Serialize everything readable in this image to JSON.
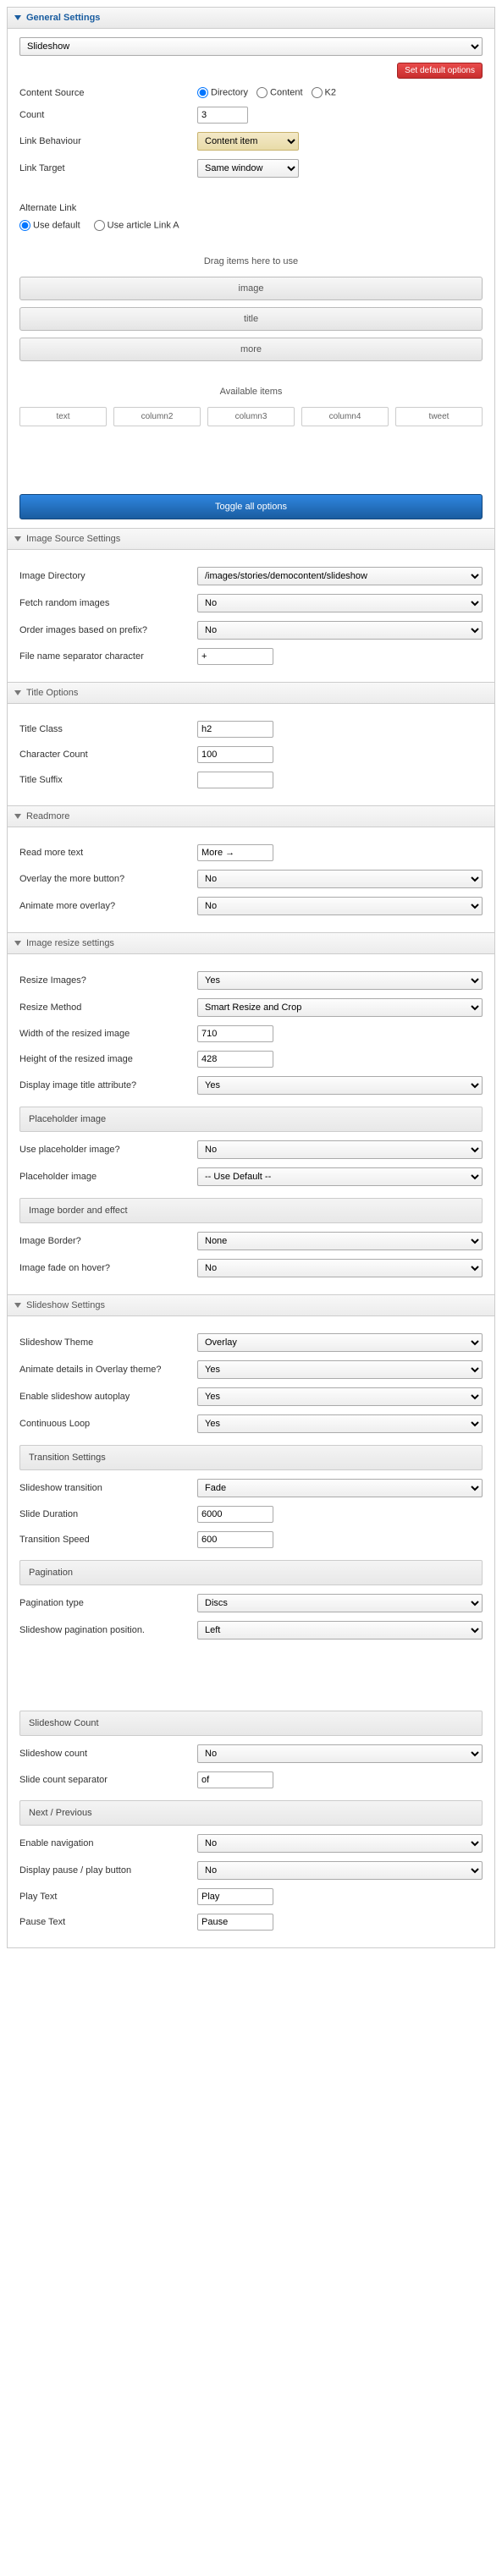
{
  "sections": {
    "general": {
      "title": "General Settings"
    },
    "imageSource": {
      "title": "Image Source Settings"
    },
    "titleOptions": {
      "title": "Title Options"
    },
    "readmore": {
      "title": "Readmore"
    },
    "imageResize": {
      "title": "Image resize settings"
    },
    "slideshow": {
      "title": "Slideshow Settings"
    }
  },
  "general": {
    "moduleType": "Slideshow",
    "setDefault": "Set default options",
    "contentSource": {
      "label": "Content Source",
      "options": [
        "Directory",
        "Content",
        "K2"
      ],
      "selected": "Directory"
    },
    "count": {
      "label": "Count",
      "value": "3"
    },
    "linkBehaviour": {
      "label": "Link Behaviour",
      "value": "Content item"
    },
    "linkTarget": {
      "label": "Link Target",
      "value": "Same window"
    },
    "altLink": {
      "label": "Alternate Link",
      "options": [
        "Use default",
        "Use article Link A"
      ],
      "selected": "Use default"
    },
    "dragHeading": "Drag items here to use",
    "dragItems": [
      "image",
      "title",
      "more"
    ],
    "availHeading": "Available items",
    "availItems": [
      "text",
      "column2",
      "column3",
      "column4",
      "tweet"
    ],
    "toggleAll": "Toggle all options"
  },
  "imageSource": {
    "imageDirectory": {
      "label": "Image Directory",
      "value": "/images/stories/democontent/slideshow"
    },
    "fetchRandom": {
      "label": "Fetch random images",
      "value": "No"
    },
    "orderPrefix": {
      "label": "Order images based on prefix?",
      "value": "No"
    },
    "separator": {
      "label": "File name separator character",
      "value": "+"
    }
  },
  "titleOptions": {
    "titleClass": {
      "label": "Title Class",
      "value": "h2"
    },
    "charCount": {
      "label": "Character Count",
      "value": "100"
    },
    "titleSuffix": {
      "label": "Title Suffix",
      "value": ""
    }
  },
  "readmore": {
    "readMoreText": {
      "label": "Read more text",
      "value": "More →"
    },
    "overlayMore": {
      "label": "Overlay the more button?",
      "value": "No"
    },
    "animateMore": {
      "label": "Animate more overlay?",
      "value": "No"
    }
  },
  "imageResize": {
    "resize": {
      "label": "Resize Images?",
      "value": "Yes"
    },
    "method": {
      "label": "Resize Method",
      "value": "Smart Resize and Crop"
    },
    "width": {
      "label": "Width of the resized image",
      "value": "710"
    },
    "height": {
      "label": "Height of the resized image",
      "value": "428"
    },
    "displayTitle": {
      "label": "Display image title attribute?",
      "value": "Yes"
    },
    "placeholderHead": "Placeholder image",
    "usePlaceholder": {
      "label": "Use placeholder image?",
      "value": "No"
    },
    "placeholderImg": {
      "label": "Placeholder image",
      "value": "-- Use Default --"
    },
    "borderHead": "Image border and effect",
    "border": {
      "label": "Image Border?",
      "value": "None"
    },
    "fadeHover": {
      "label": "Image fade on hover?",
      "value": "No"
    }
  },
  "slideshow": {
    "theme": {
      "label": "Slideshow Theme",
      "value": "Overlay"
    },
    "animateDetails": {
      "label": "Animate details in Overlay theme?",
      "value": "Yes"
    },
    "autoplay": {
      "label": "Enable slideshow autoplay",
      "value": "Yes"
    },
    "loop": {
      "label": "Continuous Loop",
      "value": "Yes"
    },
    "transitionHead": "Transition Settings",
    "transition": {
      "label": "Slideshow transition",
      "value": "Fade"
    },
    "duration": {
      "label": "Slide Duration",
      "value": "6000"
    },
    "speed": {
      "label": "Transition Speed",
      "value": "600"
    },
    "paginationHead": "Pagination",
    "pagType": {
      "label": "Pagination type",
      "value": "Discs"
    },
    "pagPos": {
      "label": "Slideshow pagination position.",
      "value": "Left"
    },
    "countHead": "Slideshow Count",
    "countEnable": {
      "label": "Slideshow count",
      "value": "No"
    },
    "countSep": {
      "label": "Slide count separator",
      "value": "of"
    },
    "navHead": "Next / Previous",
    "navEnable": {
      "label": "Enable navigation",
      "value": "No"
    },
    "pausePlay": {
      "label": "Display pause / play button",
      "value": "No"
    },
    "playText": {
      "label": "Play Text",
      "value": "Play"
    },
    "pauseText": {
      "label": "Pause Text",
      "value": "Pause"
    }
  }
}
